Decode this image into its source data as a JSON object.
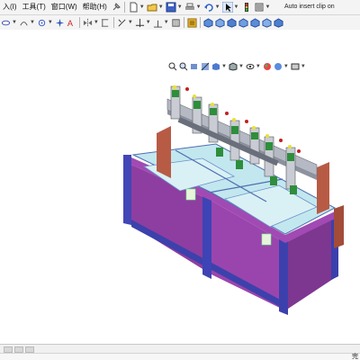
{
  "menubar": {
    "items": [
      "入(I)",
      "工具(T)",
      "窗口(W)",
      "帮助(H)"
    ]
  },
  "status_message": "Auto insert clip on",
  "statusbar": {
    "right_text": "完"
  },
  "icons": {
    "toolbar1": [
      "new-file-icon",
      "open-file-icon",
      "save-icon",
      "print-icon",
      "undo-icon",
      "select-arrow-icon",
      "rebuild-icon",
      "options-icon",
      "smart-component-icon"
    ],
    "toolbar2": [
      "sketch-icon",
      "arc-icon",
      "point-icon",
      "circle-icon",
      "text-icon",
      "mirror-icon",
      "offset-icon",
      "trim-icon",
      "move-icon",
      "relation-icon",
      "grid-icon",
      "view-icon"
    ],
    "hud": [
      "zoom-fit-icon",
      "zoom-area-icon",
      "previous-view-icon",
      "section-view-icon",
      "view-orientation-icon",
      "display-style-icon",
      "hide-show-icon",
      "appearance-icon",
      "scene-icon"
    ]
  },
  "colors": {
    "frame_purple": "#8f3fa2",
    "frame_blue": "#3f49b8",
    "glass": "#bfe6ee",
    "rust": "#b85b45",
    "background": "#ffffff"
  }
}
